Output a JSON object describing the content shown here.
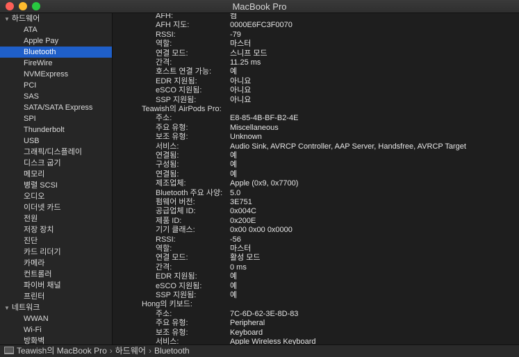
{
  "window": {
    "title": "MacBook Pro"
  },
  "sidebar": {
    "groups": [
      {
        "label": "하드웨어",
        "items": [
          "ATA",
          "Apple Pay",
          "Bluetooth",
          "FireWire",
          "NVMExpress",
          "PCI",
          "SAS",
          "SATA/SATA Express",
          "SPI",
          "Thunderbolt",
          "USB",
          "그래픽/디스플레이",
          "디스크 굽기",
          "메모리",
          "병렬 SCSI",
          "오디오",
          "이더넷 카드",
          "전원",
          "저장 장치",
          "진단",
          "카드 리더기",
          "카메라",
          "컨트롤러",
          "파이버 채널",
          "프린터"
        ]
      },
      {
        "label": "네트워크",
        "items": [
          "WWAN",
          "Wi-Fi",
          "방화벽"
        ]
      }
    ],
    "selected": "Bluetooth"
  },
  "detail": {
    "block1": [
      [
        "AFH:",
        "켬"
      ],
      [
        "AFH 지도:",
        "0000E6FC3F0070"
      ],
      [
        "RSSI:",
        "-79"
      ],
      [
        "역할:",
        "마스터"
      ],
      [
        "연결 모드:",
        "스니프 모드"
      ],
      [
        "간격:",
        "11.25 ms"
      ],
      [
        "호스트 연결 가능:",
        "예"
      ],
      [
        "EDR 지원됨:",
        "아니요"
      ],
      [
        "eSCO 지원됨:",
        "아니요"
      ],
      [
        "SSP 지원됨:",
        "아니요"
      ]
    ],
    "airpods_title": "Teawish의 AirPods Pro:",
    "airpods": [
      [
        "주소:",
        "E8-85-4B-BF-B2-4E"
      ],
      [
        "주요 유형:",
        "Miscellaneous"
      ],
      [
        "보조 유형:",
        "Unknown"
      ],
      [
        "서비스:",
        "Audio Sink, AVRCP Controller, AAP Server, Handsfree, AVRCP Target"
      ],
      [
        "연결됨:",
        "예"
      ],
      [
        "구성됨:",
        "예"
      ],
      [
        "연결됨:",
        "예"
      ],
      [
        "제조업체:",
        "Apple (0x9, 0x7700)"
      ],
      [
        "Bluetooth 주요 사양:",
        "5.0"
      ],
      [
        "펌웨어 버전:",
        "3E751"
      ],
      [
        "공급업체 ID:",
        "0x004C"
      ],
      [
        "제품 ID:",
        "0x200E"
      ],
      [
        "기기 클래스:",
        "0x00 0x00 0x0000"
      ],
      [
        "RSSI:",
        "-56"
      ],
      [
        "역할:",
        "마스터"
      ],
      [
        "연결 모드:",
        "활성 모드"
      ],
      [
        "간격:",
        "0 ms"
      ],
      [
        "EDR 지원됨:",
        "예"
      ],
      [
        "eSCO 지원됨:",
        "예"
      ],
      [
        "SSP 지원됨:",
        "예"
      ]
    ],
    "keyboard_title": "Hong의 키보드:",
    "keyboard": [
      [
        "주소:",
        "7C-6D-62-3E-8D-83"
      ],
      [
        "주요 유형:",
        "Peripheral"
      ],
      [
        "보조 유형:",
        "Keyboard"
      ],
      [
        "서비스:",
        "Apple Wireless Keyboard"
      ]
    ]
  },
  "statusbar": {
    "path": [
      "Teawish의 MacBook Pro",
      "하드웨어",
      "Bluetooth"
    ],
    "separator": "›"
  }
}
